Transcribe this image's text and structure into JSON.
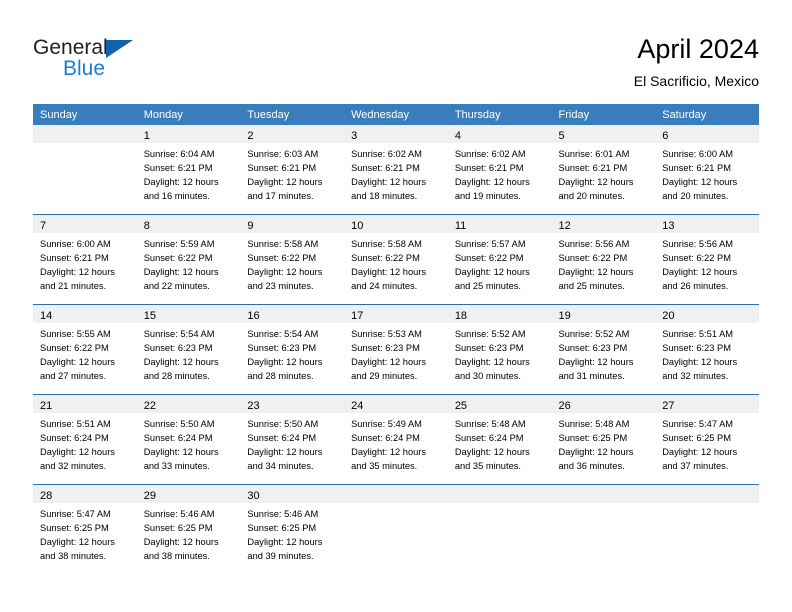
{
  "brand": {
    "name_top": "General",
    "name_bottom": "Blue",
    "triangle_color": "#1161ab",
    "blue_color": "#1c7fd1"
  },
  "header": {
    "title": "April 2024",
    "subtitle": "El Sacrificio, Mexico"
  },
  "theme": {
    "header_bg": "#3a7dbd",
    "header_text": "#ffffff",
    "row_rule": "#2e6da4",
    "daynum_band": "#f0f0f0",
    "cell_bg": "#ffffff",
    "text": "#000000"
  },
  "labels": {
    "sunrise_prefix": "Sunrise:",
    "sunset_prefix": "Sunset:",
    "daylight_prefix": "Daylight:"
  },
  "weekdays": [
    "Sunday",
    "Monday",
    "Tuesday",
    "Wednesday",
    "Thursday",
    "Friday",
    "Saturday"
  ],
  "weeks": [
    [
      {
        "day": "",
        "sunrise": "",
        "sunset": "",
        "daylight_line1": "",
        "daylight_line2": ""
      },
      {
        "day": "1",
        "sunrise": "Sunrise: 6:04 AM",
        "sunset": "Sunset: 6:21 PM",
        "daylight_line1": "Daylight: 12 hours",
        "daylight_line2": "and 16 minutes."
      },
      {
        "day": "2",
        "sunrise": "Sunrise: 6:03 AM",
        "sunset": "Sunset: 6:21 PM",
        "daylight_line1": "Daylight: 12 hours",
        "daylight_line2": "and 17 minutes."
      },
      {
        "day": "3",
        "sunrise": "Sunrise: 6:02 AM",
        "sunset": "Sunset: 6:21 PM",
        "daylight_line1": "Daylight: 12 hours",
        "daylight_line2": "and 18 minutes."
      },
      {
        "day": "4",
        "sunrise": "Sunrise: 6:02 AM",
        "sunset": "Sunset: 6:21 PM",
        "daylight_line1": "Daylight: 12 hours",
        "daylight_line2": "and 19 minutes."
      },
      {
        "day": "5",
        "sunrise": "Sunrise: 6:01 AM",
        "sunset": "Sunset: 6:21 PM",
        "daylight_line1": "Daylight: 12 hours",
        "daylight_line2": "and 20 minutes."
      },
      {
        "day": "6",
        "sunrise": "Sunrise: 6:00 AM",
        "sunset": "Sunset: 6:21 PM",
        "daylight_line1": "Daylight: 12 hours",
        "daylight_line2": "and 20 minutes."
      }
    ],
    [
      {
        "day": "7",
        "sunrise": "Sunrise: 6:00 AM",
        "sunset": "Sunset: 6:21 PM",
        "daylight_line1": "Daylight: 12 hours",
        "daylight_line2": "and 21 minutes."
      },
      {
        "day": "8",
        "sunrise": "Sunrise: 5:59 AM",
        "sunset": "Sunset: 6:22 PM",
        "daylight_line1": "Daylight: 12 hours",
        "daylight_line2": "and 22 minutes."
      },
      {
        "day": "9",
        "sunrise": "Sunrise: 5:58 AM",
        "sunset": "Sunset: 6:22 PM",
        "daylight_line1": "Daylight: 12 hours",
        "daylight_line2": "and 23 minutes."
      },
      {
        "day": "10",
        "sunrise": "Sunrise: 5:58 AM",
        "sunset": "Sunset: 6:22 PM",
        "daylight_line1": "Daylight: 12 hours",
        "daylight_line2": "and 24 minutes."
      },
      {
        "day": "11",
        "sunrise": "Sunrise: 5:57 AM",
        "sunset": "Sunset: 6:22 PM",
        "daylight_line1": "Daylight: 12 hours",
        "daylight_line2": "and 25 minutes."
      },
      {
        "day": "12",
        "sunrise": "Sunrise: 5:56 AM",
        "sunset": "Sunset: 6:22 PM",
        "daylight_line1": "Daylight: 12 hours",
        "daylight_line2": "and 25 minutes."
      },
      {
        "day": "13",
        "sunrise": "Sunrise: 5:56 AM",
        "sunset": "Sunset: 6:22 PM",
        "daylight_line1": "Daylight: 12 hours",
        "daylight_line2": "and 26 minutes."
      }
    ],
    [
      {
        "day": "14",
        "sunrise": "Sunrise: 5:55 AM",
        "sunset": "Sunset: 6:22 PM",
        "daylight_line1": "Daylight: 12 hours",
        "daylight_line2": "and 27 minutes."
      },
      {
        "day": "15",
        "sunrise": "Sunrise: 5:54 AM",
        "sunset": "Sunset: 6:23 PM",
        "daylight_line1": "Daylight: 12 hours",
        "daylight_line2": "and 28 minutes."
      },
      {
        "day": "16",
        "sunrise": "Sunrise: 5:54 AM",
        "sunset": "Sunset: 6:23 PM",
        "daylight_line1": "Daylight: 12 hours",
        "daylight_line2": "and 28 minutes."
      },
      {
        "day": "17",
        "sunrise": "Sunrise: 5:53 AM",
        "sunset": "Sunset: 6:23 PM",
        "daylight_line1": "Daylight: 12 hours",
        "daylight_line2": "and 29 minutes."
      },
      {
        "day": "18",
        "sunrise": "Sunrise: 5:52 AM",
        "sunset": "Sunset: 6:23 PM",
        "daylight_line1": "Daylight: 12 hours",
        "daylight_line2": "and 30 minutes."
      },
      {
        "day": "19",
        "sunrise": "Sunrise: 5:52 AM",
        "sunset": "Sunset: 6:23 PM",
        "daylight_line1": "Daylight: 12 hours",
        "daylight_line2": "and 31 minutes."
      },
      {
        "day": "20",
        "sunrise": "Sunrise: 5:51 AM",
        "sunset": "Sunset: 6:23 PM",
        "daylight_line1": "Daylight: 12 hours",
        "daylight_line2": "and 32 minutes."
      }
    ],
    [
      {
        "day": "21",
        "sunrise": "Sunrise: 5:51 AM",
        "sunset": "Sunset: 6:24 PM",
        "daylight_line1": "Daylight: 12 hours",
        "daylight_line2": "and 32 minutes."
      },
      {
        "day": "22",
        "sunrise": "Sunrise: 5:50 AM",
        "sunset": "Sunset: 6:24 PM",
        "daylight_line1": "Daylight: 12 hours",
        "daylight_line2": "and 33 minutes."
      },
      {
        "day": "23",
        "sunrise": "Sunrise: 5:50 AM",
        "sunset": "Sunset: 6:24 PM",
        "daylight_line1": "Daylight: 12 hours",
        "daylight_line2": "and 34 minutes."
      },
      {
        "day": "24",
        "sunrise": "Sunrise: 5:49 AM",
        "sunset": "Sunset: 6:24 PM",
        "daylight_line1": "Daylight: 12 hours",
        "daylight_line2": "and 35 minutes."
      },
      {
        "day": "25",
        "sunrise": "Sunrise: 5:48 AM",
        "sunset": "Sunset: 6:24 PM",
        "daylight_line1": "Daylight: 12 hours",
        "daylight_line2": "and 35 minutes."
      },
      {
        "day": "26",
        "sunrise": "Sunrise: 5:48 AM",
        "sunset": "Sunset: 6:25 PM",
        "daylight_line1": "Daylight: 12 hours",
        "daylight_line2": "and 36 minutes."
      },
      {
        "day": "27",
        "sunrise": "Sunrise: 5:47 AM",
        "sunset": "Sunset: 6:25 PM",
        "daylight_line1": "Daylight: 12 hours",
        "daylight_line2": "and 37 minutes."
      }
    ],
    [
      {
        "day": "28",
        "sunrise": "Sunrise: 5:47 AM",
        "sunset": "Sunset: 6:25 PM",
        "daylight_line1": "Daylight: 12 hours",
        "daylight_line2": "and 38 minutes."
      },
      {
        "day": "29",
        "sunrise": "Sunrise: 5:46 AM",
        "sunset": "Sunset: 6:25 PM",
        "daylight_line1": "Daylight: 12 hours",
        "daylight_line2": "and 38 minutes."
      },
      {
        "day": "30",
        "sunrise": "Sunrise: 5:46 AM",
        "sunset": "Sunset: 6:25 PM",
        "daylight_line1": "Daylight: 12 hours",
        "daylight_line2": "and 39 minutes."
      },
      {
        "day": "",
        "sunrise": "",
        "sunset": "",
        "daylight_line1": "",
        "daylight_line2": ""
      },
      {
        "day": "",
        "sunrise": "",
        "sunset": "",
        "daylight_line1": "",
        "daylight_line2": ""
      },
      {
        "day": "",
        "sunrise": "",
        "sunset": "",
        "daylight_line1": "",
        "daylight_line2": ""
      },
      {
        "day": "",
        "sunrise": "",
        "sunset": "",
        "daylight_line1": "",
        "daylight_line2": ""
      }
    ]
  ]
}
